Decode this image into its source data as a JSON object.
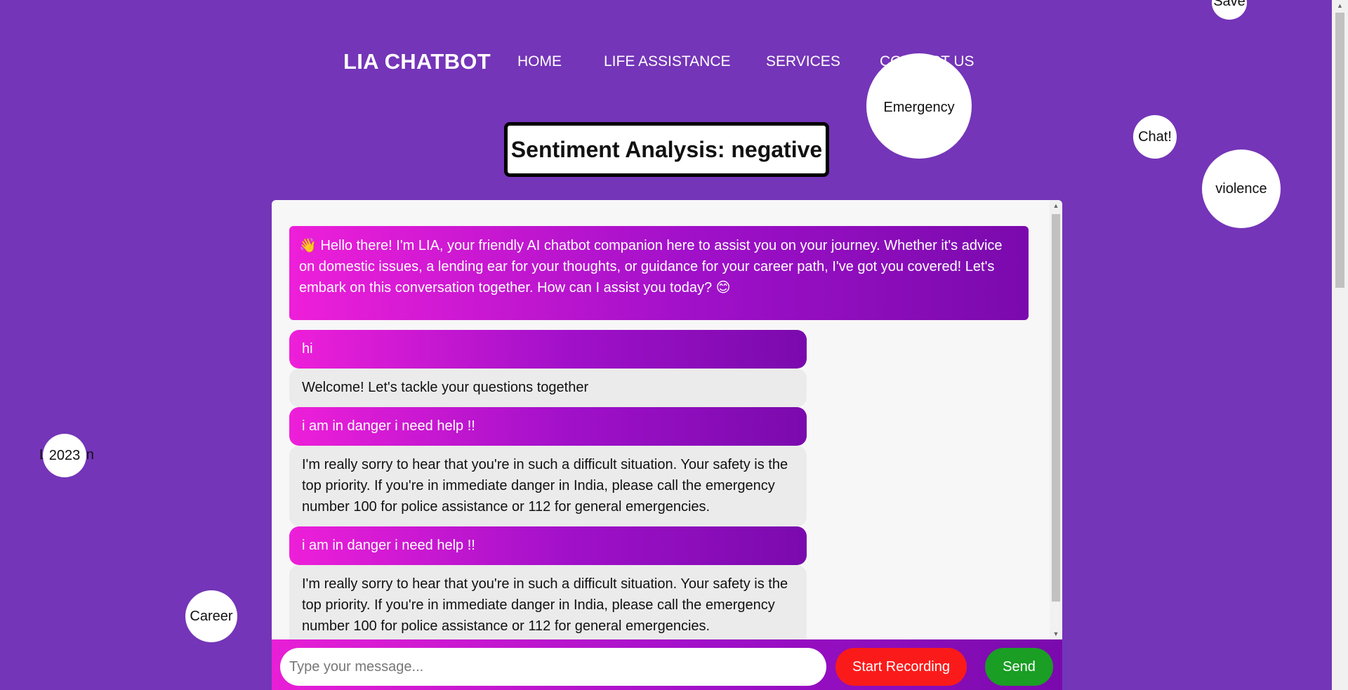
{
  "nav": {
    "brand": "LIA CHATBOT",
    "links": [
      "HOME",
      "LIFE ASSISTANCE",
      "SERVICES",
      "CONTACT US"
    ]
  },
  "sentiment": {
    "text": "Sentiment Analysis: negative"
  },
  "bubbles": {
    "save": "Save",
    "emergency": "Emergency",
    "chat": "Chat!",
    "violence": "violence",
    "year": "2023",
    "career": "Career"
  },
  "chat": {
    "welcome": "👋 Hello there! I'm LIA, your friendly AI chatbot companion here to assist you on your journey. Whether it's advice on domestic issues, a lending ear for your thoughts, or guidance for your career path, I've got you covered! Let's embark on this conversation together. How can I assist you today? 😊",
    "messages": [
      {
        "role": "user",
        "text": "hi"
      },
      {
        "role": "bot",
        "text": "Welcome! Let's tackle your questions together"
      },
      {
        "role": "user",
        "text": "i am in danger i need help !!"
      },
      {
        "role": "bot",
        "text": "I'm really sorry to hear that you're in such a difficult situation. Your safety is the top priority. If you're in immediate danger in India, please call the emergency number 100 for police assistance or 112 for general emergencies."
      },
      {
        "role": "user",
        "text": "i am in danger i need help !!"
      },
      {
        "role": "bot",
        "text": "I'm really sorry to hear that you're in such a difficult situation. Your safety is the top priority. If you're in immediate danger in India, please call the emergency number 100 for police assistance or 112 for general emergencies."
      }
    ]
  },
  "input": {
    "placeholder": "Type your message...",
    "value": "",
    "record_label": "Start Recording",
    "send_label": "Send"
  },
  "colors": {
    "background": "#7435b8",
    "gradient_start": "#ee1fd9",
    "gradient_end": "#7a0aad",
    "record_button": "#fb1a1a",
    "send_button": "#1a9e24"
  }
}
